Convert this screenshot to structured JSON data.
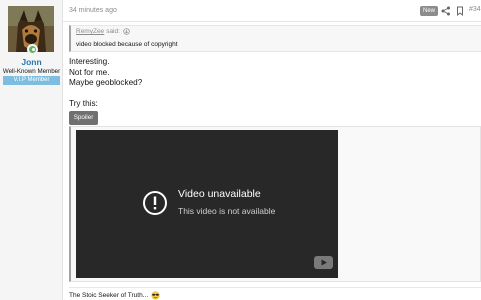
{
  "author": {
    "username": "Jonn",
    "title": "Well-Known Member",
    "banner": "V.I.P Member",
    "online": true
  },
  "post": {
    "time": "34 minutes ago",
    "badge": "New",
    "number": "#34",
    "icons": [
      "share-icon",
      "bookmark-icon"
    ]
  },
  "quote": {
    "author": "RemyZee",
    "said_label": "said:",
    "text": "video blocked because of copyright"
  },
  "message": {
    "lines": [
      "Interesting.",
      "Not for me.",
      "Maybe geoblocked?"
    ],
    "try_label": "Try this:"
  },
  "spoiler": {
    "button_label": "Spoiler"
  },
  "video": {
    "title": "Video unavailable",
    "subtitle": "This video is not available",
    "icons": [
      "alert-icon",
      "youtube-logo"
    ]
  },
  "signature": {
    "text": "The Stoic Seeker of Truth...",
    "emoji": "sunglasses-emoji"
  },
  "colors": {
    "username": "#2577b1",
    "banner": "#7ebde0",
    "online": "#63b265",
    "video_bg": "#282828"
  }
}
